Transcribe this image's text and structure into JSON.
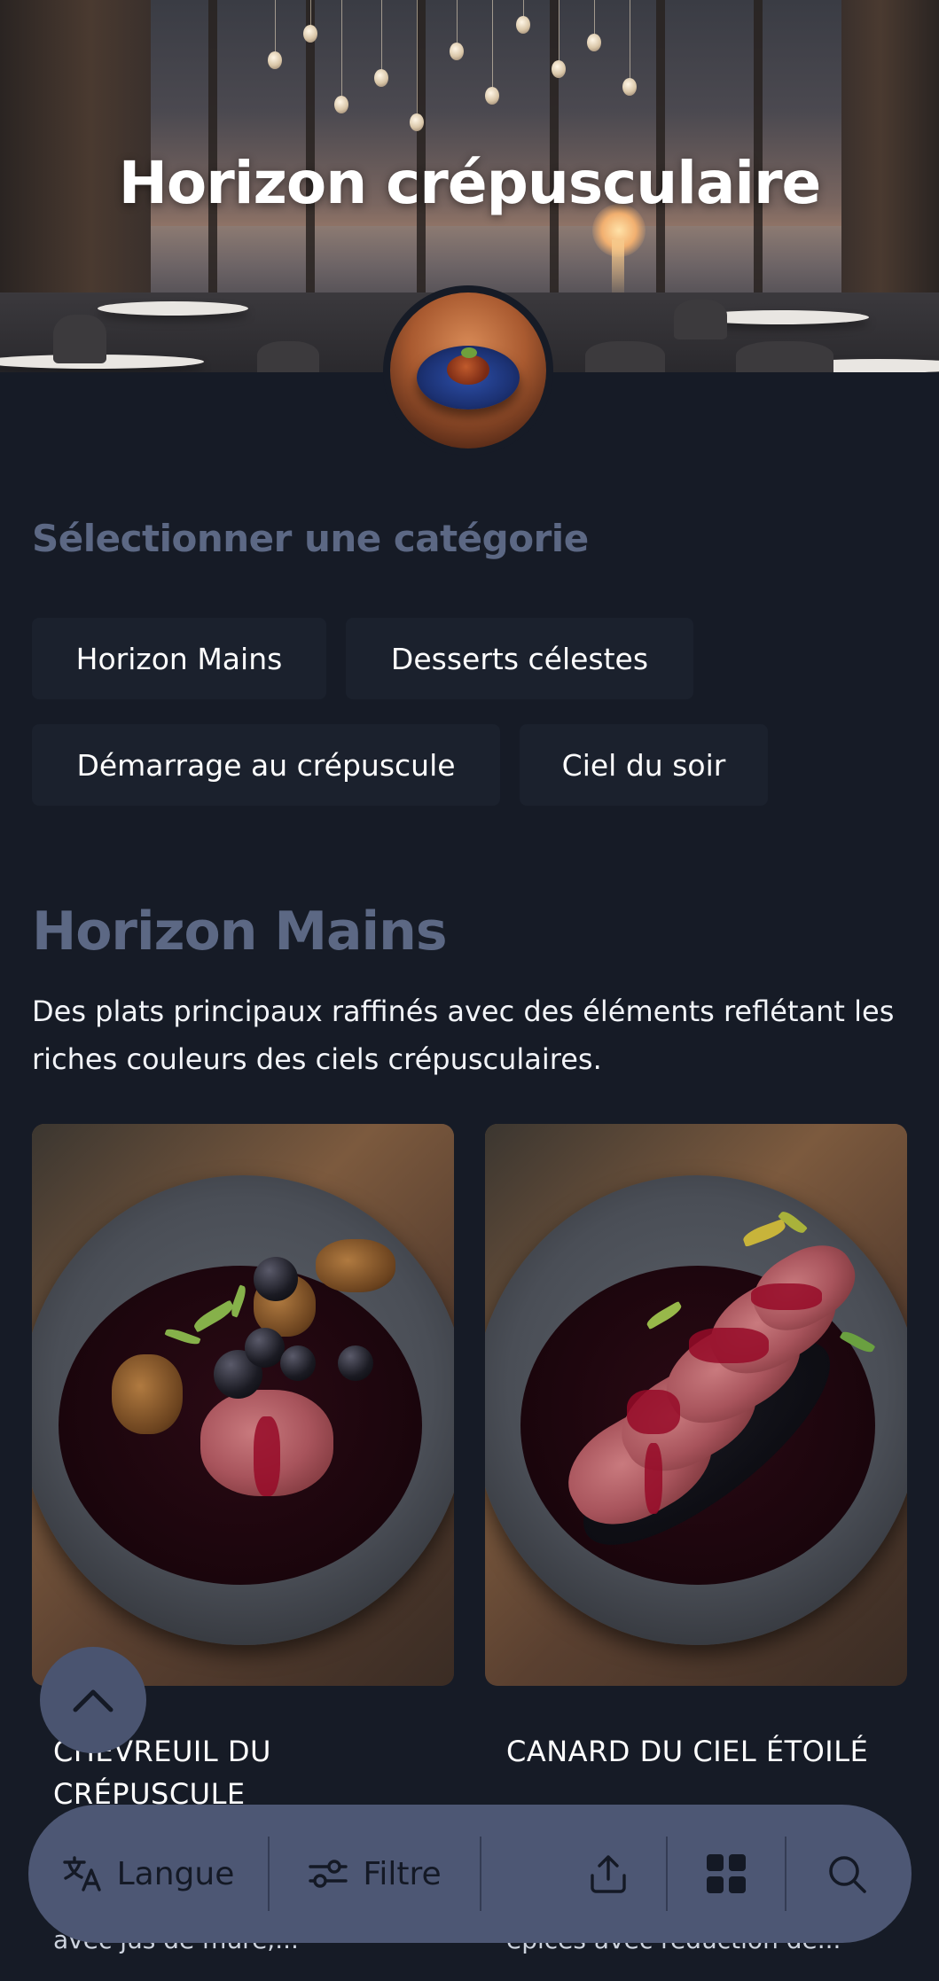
{
  "hero": {
    "title": "Horizon crépusculaire"
  },
  "category_picker": {
    "label": "Sélectionner une catégorie",
    "chips": [
      {
        "label": "Horizon Mains"
      },
      {
        "label": "Desserts célestes"
      },
      {
        "label": "Démarrage au crépuscule"
      },
      {
        "label": "Ciel du soir"
      }
    ]
  },
  "category": {
    "title": "Horizon Mains",
    "description": "Des plats principaux raffinés avec des éléments reflétant les riches couleurs des ciels crépusculaires."
  },
  "dishes": [
    {
      "name": "CHEVREUIL DU CRÉPUSCULE",
      "subtitle": "avec jus de mûre,..."
    },
    {
      "name": "CANARD DU CIEL ÉTOILÉ",
      "subtitle": "épices avec réduction de..."
    }
  ],
  "toolbar": {
    "language_label": "Langue",
    "filter_label": "Filtre"
  },
  "colors": {
    "background": "#161b26",
    "accent_muted": "#5c6884",
    "toolbar": "#4d5774",
    "chip": "#1b212d"
  },
  "icons": [
    "translate-icon",
    "filter-icon",
    "share-icon",
    "grid-icon",
    "search-icon",
    "chevron-up-icon"
  ]
}
